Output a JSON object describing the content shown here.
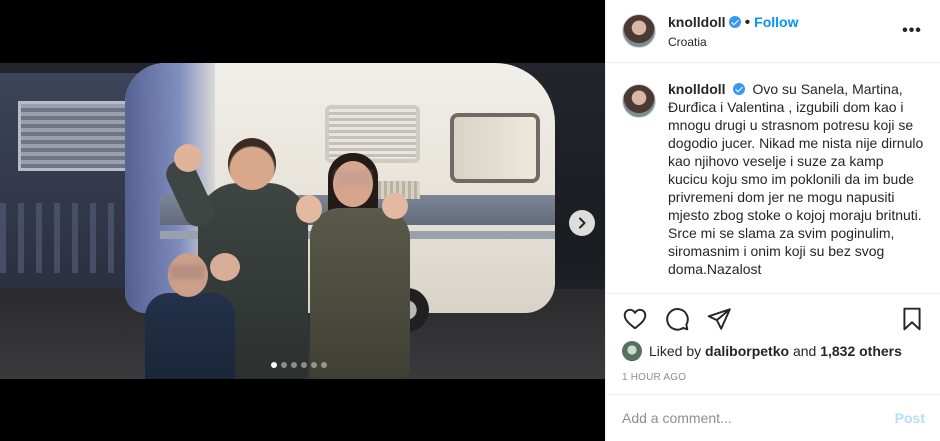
{
  "header": {
    "username": "knolldoll",
    "separator": "•",
    "follow_label": "Follow",
    "location": "Croatia",
    "more_label": "•••"
  },
  "caption": {
    "username": "knolldoll",
    "text": "Ovo su Sanela, Martina, Đurđica i Valentina , izgubili dom kao i mnogu drugi u strasnom potresu koji se dogodio jucer. Nikad me nista nije dirnulo kao njihovo veselje i suze za kamp kucicu koju smo im poklonili da im bude privremeni dom jer ne mogu napusiti mjesto zbog stoke o kojoj moraju britnuti. Srce mi se slama za svim poginulim, siromasnim i onim koji su bez svog doma.Nazalost"
  },
  "actions": {
    "like_icon": "heart-icon",
    "comment_icon": "comment-icon",
    "share_icon": "paper-plane-icon",
    "save_icon": "bookmark-icon"
  },
  "likes": {
    "prefix": "Liked by",
    "user": "daliborpetko",
    "middle": "and",
    "others": "1,832 others"
  },
  "timestamp": "1 hour ago",
  "comment": {
    "placeholder": "Add a comment...",
    "post_label": "Post"
  },
  "carousel": {
    "total": 6,
    "active_index": 0,
    "next_icon": "chevron-right-icon"
  },
  "colors": {
    "link": "#0095f6",
    "verified": "#3897f0",
    "post_disabled": "#b2dffc",
    "muted": "#8e8e8e"
  }
}
